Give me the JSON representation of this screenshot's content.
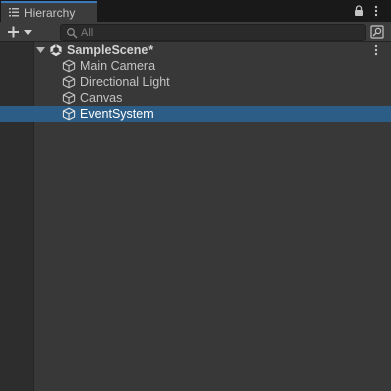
{
  "window": {
    "tab_label": "Hierarchy",
    "tab_icon": "list-icon",
    "lock_icon": "lock-icon",
    "menu_icon": "kebab-menu-icon",
    "accent_color": "#3a79bb"
  },
  "toolbar": {
    "create_icon": "plus-dropdown-icon",
    "search_placeholder": "All",
    "search_icon": "search-icon",
    "search_mode_icon": "search-by-type-icon"
  },
  "scene": {
    "name": "SampleScene*",
    "icon": "unity-logo-icon",
    "expanded": true,
    "menu_icon": "kebab-menu-icon"
  },
  "objects": [
    {
      "name": "Main Camera",
      "icon": "gameobject-cube-icon",
      "selected": false
    },
    {
      "name": "Directional Light",
      "icon": "gameobject-cube-icon",
      "selected": false
    },
    {
      "name": "Canvas",
      "icon": "gameobject-cube-icon",
      "selected": false
    },
    {
      "name": "EventSystem",
      "icon": "gameobject-cube-icon",
      "selected": true
    }
  ],
  "colors": {
    "selection": "#2c5d87",
    "background": "#383838",
    "gutter": "#2d2d2d"
  }
}
